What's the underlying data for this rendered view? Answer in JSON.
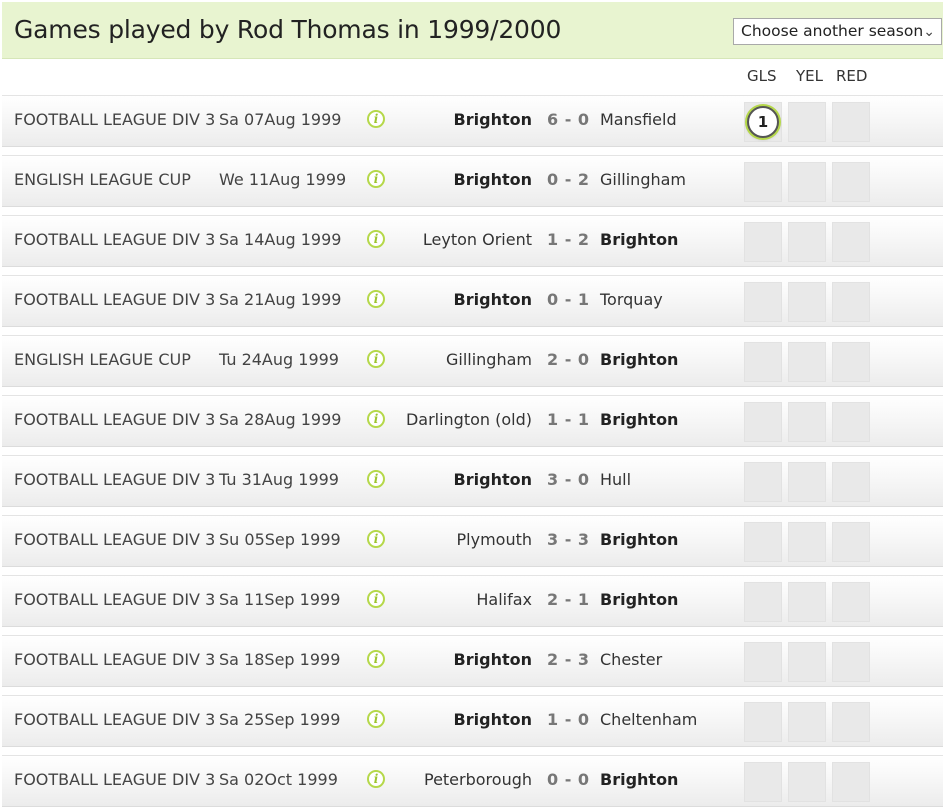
{
  "page": {
    "title": "Games played by Rod Thomas in 1999/2000",
    "season_select_label": "Choose another season"
  },
  "columns": {
    "goals": "GLS",
    "yellow": "YEL",
    "red": "RED"
  },
  "team": "Brighton",
  "games": [
    {
      "competition": "FOOTBALL LEAGUE DIV 3",
      "date": "Sa 07Aug 1999",
      "home": "Brighton",
      "score": "6 - 0",
      "away": "Mansfield",
      "goals": "1"
    },
    {
      "competition": "ENGLISH LEAGUE CUP",
      "date": "We 11Aug 1999",
      "home": "Brighton",
      "score": "0 - 2",
      "away": "Gillingham",
      "goals": ""
    },
    {
      "competition": "FOOTBALL LEAGUE DIV 3",
      "date": "Sa 14Aug 1999",
      "home": "Leyton Orient",
      "score": "1 - 2",
      "away": "Brighton",
      "goals": ""
    },
    {
      "competition": "FOOTBALL LEAGUE DIV 3",
      "date": "Sa 21Aug 1999",
      "home": "Brighton",
      "score": "0 - 1",
      "away": "Torquay",
      "goals": ""
    },
    {
      "competition": "ENGLISH LEAGUE CUP",
      "date": "Tu 24Aug 1999",
      "home": "Gillingham",
      "score": "2 - 0",
      "away": "Brighton",
      "goals": ""
    },
    {
      "competition": "FOOTBALL LEAGUE DIV 3",
      "date": "Sa 28Aug 1999",
      "home": "Darlington (old)",
      "score": "1 - 1",
      "away": "Brighton",
      "goals": ""
    },
    {
      "competition": "FOOTBALL LEAGUE DIV 3",
      "date": "Tu 31Aug 1999",
      "home": "Brighton",
      "score": "3 - 0",
      "away": "Hull",
      "goals": ""
    },
    {
      "competition": "FOOTBALL LEAGUE DIV 3",
      "date": "Su 05Sep 1999",
      "home": "Plymouth",
      "score": "3 - 3",
      "away": "Brighton",
      "goals": ""
    },
    {
      "competition": "FOOTBALL LEAGUE DIV 3",
      "date": "Sa 11Sep 1999",
      "home": "Halifax",
      "score": "2 - 1",
      "away": "Brighton",
      "goals": ""
    },
    {
      "competition": "FOOTBALL LEAGUE DIV 3",
      "date": "Sa 18Sep 1999",
      "home": "Brighton",
      "score": "2 - 3",
      "away": "Chester",
      "goals": ""
    },
    {
      "competition": "FOOTBALL LEAGUE DIV 3",
      "date": "Sa 25Sep 1999",
      "home": "Brighton",
      "score": "1 - 0",
      "away": "Cheltenham",
      "goals": ""
    },
    {
      "competition": "FOOTBALL LEAGUE DIV 3",
      "date": "Sa 02Oct 1999",
      "home": "Peterborough",
      "score": "0 - 0",
      "away": "Brighton",
      "goals": ""
    }
  ],
  "icons": {
    "info": "info-icon",
    "dropdown": "chevron-down-icon"
  },
  "colors": {
    "header_bg": "#e8f4d0",
    "accent": "#b5d84a"
  }
}
